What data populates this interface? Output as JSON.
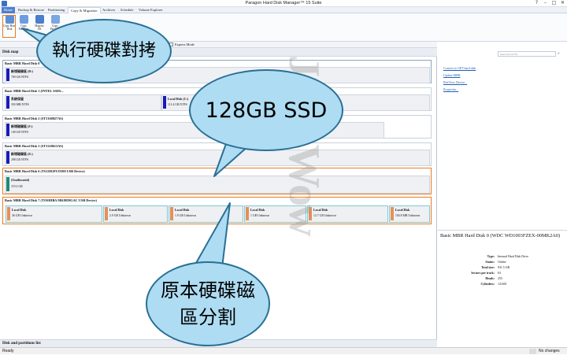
{
  "window": {
    "title": "Paragon Hard Disk Manager™ 15 Suite",
    "controls": [
      "?",
      "–",
      "□",
      "✕"
    ]
  },
  "menu": {
    "tabs": [
      "Home",
      "Backup & Restore",
      "Partitioning",
      "Copy & Migration",
      "Archives",
      "Schedule",
      "Volume Explorer"
    ],
    "active": "Copy & Migration"
  },
  "ribbon": {
    "buttons": [
      {
        "label": "Copy Hard Disk",
        "icon": "copy-disk-icon"
      },
      {
        "label": "Copy Partition",
        "icon": "copy-partition-icon"
      },
      {
        "label": "Migrate OS",
        "icon": "migrate-os-icon"
      },
      {
        "label": "Copy Partition",
        "icon": "copy-icon"
      }
    ]
  },
  "subbar": {
    "mode_label": "Express Mode"
  },
  "diskmap": {
    "header": "Disk map",
    "disks": [
      {
        "title": "Basic MBR Hard Disk 0",
        "parts": [
          {
            "label": "新增磁碟區 (D:)",
            "size": "700 GB NTFS",
            "color": "#1a1ab8"
          }
        ]
      },
      {
        "title": "Basic MBR Hard Disk 1 (INTEL SSDS...",
        "parts": [
          {
            "label": "系統保留",
            "size": "350 MB NTFS",
            "color": "#1a1ab8"
          },
          {
            "label": "Local Disk (C:)",
            "size": "111.4 GB NTFS",
            "color": "#1a1ab8"
          }
        ]
      },
      {
        "title": "Basic MBR Hard Disk 2 (ST3160827AS)",
        "parts": [
          {
            "label": "新增磁碟區 (F:)",
            "size": "149 GB NTFS",
            "color": "#1a1ab8"
          }
        ]
      },
      {
        "title": "Basic MBR Hard Disk 3 (ST3320613AS)",
        "parts": [
          {
            "label": "新增磁碟區 (E:)",
            "size": "298 GB NTFS",
            "color": "#1a1ab8"
          }
        ]
      },
      {
        "title": "Basic MBR Hard Disk 6 (TS128GPS D300 USB Device)",
        "parts": [
          {
            "label": "(Unallocated)",
            "size": "119.2 GB",
            "color": "#1c8a78"
          }
        ]
      },
      {
        "title": "Basic MBR Hard Disk 7 (TOSHIBA MK8059GAC USB Device)",
        "parts": [
          {
            "label": "Local Disk",
            "size": "36 GB Unknown",
            "color": "#e4905a"
          },
          {
            "label": "Local Disk",
            "size": "2.9 GB Unknown",
            "color": "#e4905a"
          },
          {
            "label": "Local Disk",
            "size": "1.8 GB Unknown",
            "color": "#e4905a"
          },
          {
            "label": "Local Disk",
            "size": "1 GB Unknown",
            "color": "#e4905a"
          },
          {
            "label": "Local Disk",
            "size": "12.7 GB Unknown",
            "color": "#e4905a"
          },
          {
            "label": "Local Disk",
            "size": "104.8 MB Unknown",
            "color": "#e4905a"
          }
        ]
      }
    ],
    "bottom_header": "Disk and partitions list"
  },
  "right": {
    "search_placeholder": "Search (Ctrl+F)",
    "links": [
      "Convert to GPT hard disk",
      "Update MBR",
      "BitsView Device...",
      "Properties..."
    ],
    "props_title": "Basic MBR Hard Disk 0 (WDC WD1003FZEX-00MK2A0)",
    "props": [
      {
        "k": "Type:",
        "v": "Internal Hard Disk Drive"
      },
      {
        "k": "Status:",
        "v": "Online"
      },
      {
        "k": "Total size:",
        "v": "931.5 GB"
      },
      {
        "k": "Sectors per track:",
        "v": "63"
      },
      {
        "k": "Heads:",
        "v": "255"
      },
      {
        "k": "Cylinders:",
        "v": "121601"
      }
    ]
  },
  "status": {
    "left": "Ready",
    "right": "No changes"
  },
  "callouts": {
    "copy_disk": "執行硬碟對拷",
    "ssd": "128GB SSD",
    "original": "原本硬碟磁區分割"
  },
  "watermark": "JayBWow"
}
